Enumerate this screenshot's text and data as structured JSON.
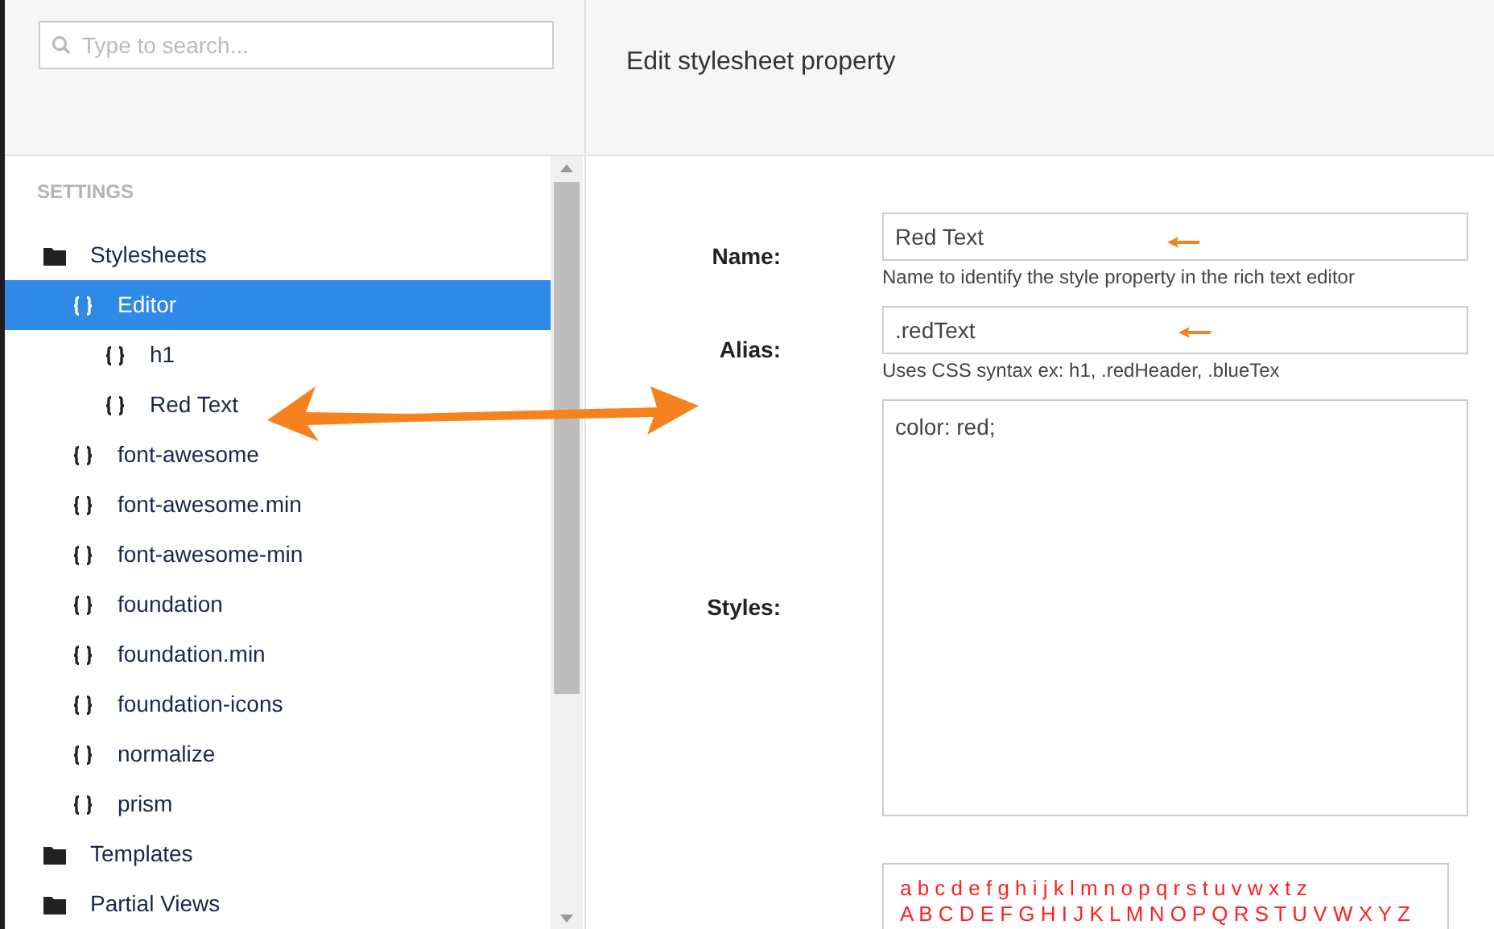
{
  "search": {
    "placeholder": "Type to search..."
  },
  "page_title": "Edit stylesheet property",
  "sidebar": {
    "heading": "SETTINGS",
    "tree": [
      {
        "label": "Stylesheets",
        "kind": "folder",
        "selected": false,
        "children": [
          {
            "label": "Editor",
            "kind": "stylesheet",
            "selected": true,
            "children": [
              {
                "label": "h1",
                "kind": "stylesheet",
                "selected": false
              },
              {
                "label": "Red Text",
                "kind": "stylesheet",
                "selected": false
              }
            ]
          },
          {
            "label": "font-awesome",
            "kind": "stylesheet",
            "selected": false
          },
          {
            "label": "font-awesome.min",
            "kind": "stylesheet",
            "selected": false
          },
          {
            "label": "font-awesome-min",
            "kind": "stylesheet",
            "selected": false
          },
          {
            "label": "foundation",
            "kind": "stylesheet",
            "selected": false
          },
          {
            "label": "foundation.min",
            "kind": "stylesheet",
            "selected": false
          },
          {
            "label": "foundation-icons",
            "kind": "stylesheet",
            "selected": false
          },
          {
            "label": "normalize",
            "kind": "stylesheet",
            "selected": false
          },
          {
            "label": "prism",
            "kind": "stylesheet",
            "selected": false
          }
        ]
      },
      {
        "label": "Templates",
        "kind": "folder",
        "selected": false
      },
      {
        "label": "Partial Views",
        "kind": "folder",
        "selected": false
      }
    ]
  },
  "form": {
    "fields": [
      {
        "label": "Name:",
        "kind": "input",
        "value": "Red Text",
        "help": "Name to identify the style property in the rich text editor"
      },
      {
        "label": "Alias:",
        "kind": "input",
        "value": ".redText",
        "help": "Uses CSS syntax ex: h1, .redHeader, .blueTex"
      },
      {
        "label": "Styles:",
        "kind": "textarea",
        "value": "color: red;"
      }
    ],
    "preview": {
      "lines": [
        "a b c d e f g h i j k l m n o p q r s t u v w x t z",
        "A B C D E F G H I J K L M N O P Q R S T U V W X Y Z"
      ],
      "color": "#ff2020"
    }
  }
}
